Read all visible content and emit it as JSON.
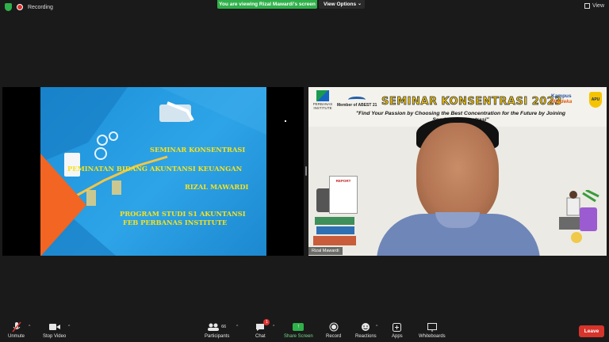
{
  "topbar": {
    "recording_label": "Recording",
    "banner_text": "You are viewing Rizal Mawardi's screen",
    "view_options_label": "View Options",
    "view_label": "View"
  },
  "shared_slide": {
    "lines": [
      "SEMINAR KONSENTRASI",
      "PEMINATAN BIDANG AKUNTANSI KEUANGAN",
      "RIZAL MAWARDI",
      "PROGRAM STUDI S1 AKUNTANSI",
      "FEB PERBANAS INSTITUTE"
    ],
    "colors": {
      "background": "#2ea4e8",
      "text": "#f7e11b",
      "accent": "#f26522"
    }
  },
  "participant_video": {
    "banner_title": "SEMINAR KONSENTRASI 2023",
    "quote": "\"Find Your Passion by Choosing the Best Concentration for the Future by Joining Seminar Konsentrasi\"",
    "logo_perbanas": "PERBANAS INSTITUTE",
    "logo_abest": "Member of ABEST 21",
    "logo_kampus": "Kampus",
    "logo_merdeka": "Merdeka",
    "logo_apu": "APU",
    "report_label": "REPORT",
    "name_label": "Rizal Mawardi"
  },
  "toolbar": {
    "unmute": "Unmute",
    "stop_video": "Stop Video",
    "participants": "Participants",
    "participants_count": "66",
    "chat": "Chat",
    "chat_badge": "1",
    "share_screen": "Share Screen",
    "record": "Record",
    "reactions": "Reactions",
    "apps": "Apps",
    "whiteboards": "Whiteboards",
    "leave": "Leave"
  }
}
